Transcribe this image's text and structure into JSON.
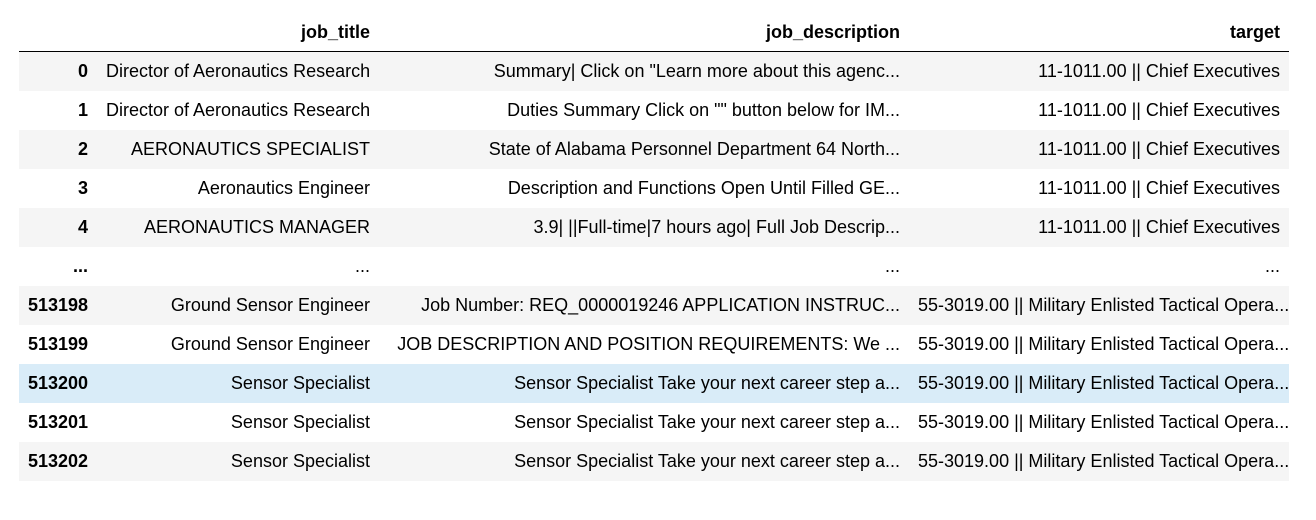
{
  "columns": {
    "index": "",
    "job_title": "job_title",
    "job_description": "job_description",
    "target": "target"
  },
  "rows": [
    {
      "index": "0",
      "job_title": "Director of Aeronautics Research",
      "job_description": "Summary| Click on \"Learn more about this agenc...",
      "target": "11-1011.00 || Chief Executives"
    },
    {
      "index": "1",
      "job_title": "Director of Aeronautics Research",
      "job_description": "Duties Summary Click on \"\" button below for IM...",
      "target": "11-1011.00 || Chief Executives"
    },
    {
      "index": "2",
      "job_title": "AERONAUTICS SPECIALIST",
      "job_description": "State of Alabama Personnel Department 64 North...",
      "target": "11-1011.00 || Chief Executives"
    },
    {
      "index": "3",
      "job_title": "Aeronautics Engineer",
      "job_description": "Description and Functions Open Until Filled GE...",
      "target": "11-1011.00 || Chief Executives"
    },
    {
      "index": "4",
      "job_title": "AERONAUTICS MANAGER",
      "job_description": "3.9| ||Full-time|7 hours ago| Full Job Descrip...",
      "target": "11-1011.00 || Chief Executives"
    },
    {
      "index": "...",
      "job_title": "...",
      "job_description": "...",
      "target": "..."
    },
    {
      "index": "513198",
      "job_title": "Ground Sensor Engineer",
      "job_description": "Job Number: REQ_0000019246 APPLICATION INSTRUC...",
      "target": "55-3019.00 || Military Enlisted Tactical Opera..."
    },
    {
      "index": "513199",
      "job_title": "Ground Sensor Engineer",
      "job_description": "JOB DESCRIPTION AND POSITION REQUIREMENTS: We ...",
      "target": "55-3019.00 || Military Enlisted Tactical Opera..."
    },
    {
      "index": "513200",
      "job_title": "Sensor Specialist",
      "job_description": "Sensor Specialist Take your next career step a...",
      "target": "55-3019.00 || Military Enlisted Tactical Opera..."
    },
    {
      "index": "513201",
      "job_title": "Sensor Specialist",
      "job_description": "Sensor Specialist Take your next career step a...",
      "target": "55-3019.00 || Military Enlisted Tactical Opera..."
    },
    {
      "index": "513202",
      "job_title": "Sensor Specialist",
      "job_description": "Sensor Specialist Take your next career step a...",
      "target": "55-3019.00 || Military Enlisted Tactical Opera..."
    }
  ],
  "highlighted_row": 8,
  "colors": {
    "striped_row": "#f5f5f5",
    "hover_row": "#d9ecf8",
    "header_border": "#000000"
  }
}
